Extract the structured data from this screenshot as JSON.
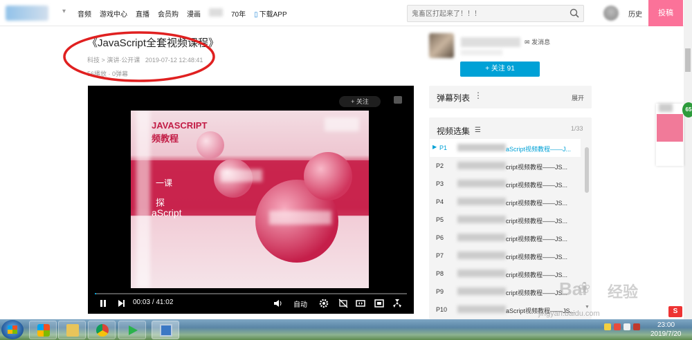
{
  "header": {
    "nav": [
      "音频",
      "游戏中心",
      "直播",
      "会员购",
      "漫画",
      "70年"
    ],
    "download_app": "下载APP",
    "search_placeholder": "鬼畜区打起来了！！！",
    "history": "历史",
    "upload": "投稿"
  },
  "video": {
    "title": "《JavaScript全套视频课程》",
    "category_main": "科技",
    "category_sep": ">",
    "category_sub": "演讲·公开课",
    "datetime": "2019-07-12 12:48:41",
    "plays": "56播放",
    "stat_sep": "·",
    "danmaku_count": "0弹幕"
  },
  "player": {
    "follow": "+ 关注",
    "current_time": "00:03",
    "time_sep": "/",
    "duration": "41:02",
    "quality": "自动",
    "progress_fraction": 0.001,
    "slide_title_1": "JAVASCRIPT",
    "slide_title_2": "频教程",
    "slide_lesson": "一课",
    "slide_explore": "探",
    "slide_js": "aScript"
  },
  "uploader": {
    "message": "发消息",
    "follow_button": "+ 关注 91"
  },
  "danmaku_panel": {
    "title": "弹幕列表",
    "more": "⋮",
    "expand": "展开"
  },
  "episodes": {
    "title": "视频选集",
    "count": "1/33",
    "items": [
      {
        "num": "P1",
        "text": "aScript视频教程——J...",
        "active": true
      },
      {
        "num": "P2",
        "text": "cript视频教程——JS...",
        "active": false
      },
      {
        "num": "P3",
        "text": "cript视频教程——JS...",
        "active": false
      },
      {
        "num": "P4",
        "text": "cript视频教程——JS...",
        "active": false
      },
      {
        "num": "P5",
        "text": "cript视频教程——JS...",
        "active": false
      },
      {
        "num": "P6",
        "text": "cript视频教程——JS...",
        "active": false
      },
      {
        "num": "P7",
        "text": "cript视频教程——JS...",
        "active": false
      },
      {
        "num": "P8",
        "text": "cript视频教程——JS...",
        "active": false
      },
      {
        "num": "P9",
        "text": "cript视频教程——JS...",
        "active": false
      },
      {
        "num": "P10",
        "text": "aScript视频教程——JS...",
        "active": false
      }
    ]
  },
  "side": {
    "badge": "65",
    "csdn": "S"
  },
  "watermark": {
    "brand": "Bai",
    "paw": "❀",
    "cn": "经验",
    "url": "jingyan.baidu.com"
  },
  "taskbar": {
    "time": "23:00",
    "date": "2019/7/20"
  },
  "colors": {
    "accent": "#00a1d6",
    "upload_pink": "#fb7299",
    "annotation_red": "#e02020"
  }
}
